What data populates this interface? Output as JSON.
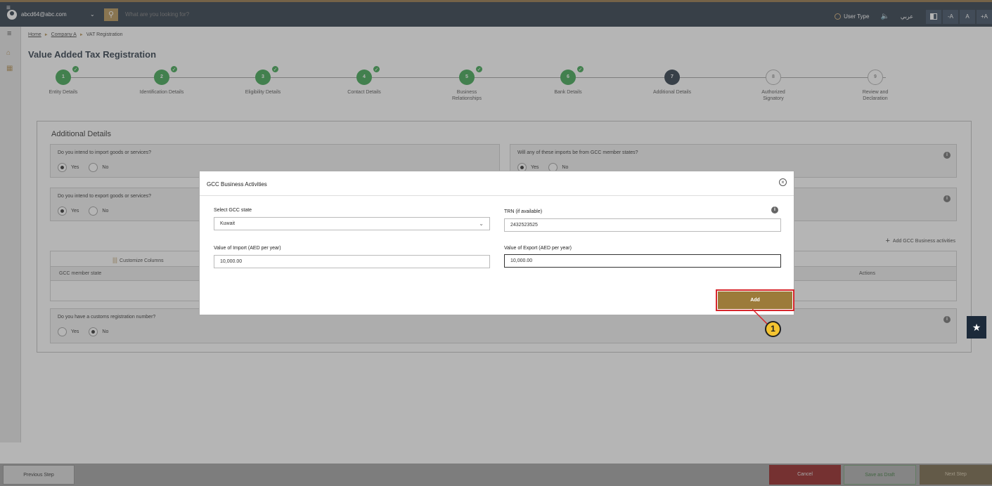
{
  "topbar": {
    "user_email": "abcd64@abc.com",
    "search_placeholder": "What are you looking for?",
    "user_type_label": "User Type",
    "arabic_label": "عربي",
    "font_decrease": "-A",
    "font_reset": "A",
    "font_increase": "+A"
  },
  "breadcrumb": {
    "home": "Home",
    "company": "Company A",
    "current": "VAT Registration"
  },
  "page_title": "Value Added Tax Registration",
  "steps": [
    {
      "num": "1",
      "label": "Entity Details",
      "state": "done"
    },
    {
      "num": "2",
      "label": "Identification Details",
      "state": "done"
    },
    {
      "num": "3",
      "label": "Eligibility Details",
      "state": "done"
    },
    {
      "num": "4",
      "label": "Contact Details",
      "state": "done"
    },
    {
      "num": "5",
      "label": "Business Relationships",
      "state": "done"
    },
    {
      "num": "6",
      "label": "Bank Details",
      "state": "done"
    },
    {
      "num": "7",
      "label": "Additional Details",
      "state": "current"
    },
    {
      "num": "8",
      "label": "Authorized Signatory",
      "state": "todo"
    },
    {
      "num": "9",
      "label": "Review and Declaration",
      "state": "todo"
    }
  ],
  "panel": {
    "title": "Additional Details",
    "q_import": "Do you intend to import goods or services?",
    "q_gcc_import": "Will any of these imports be from GCC member states?",
    "q_export": "Do you intend to export goods or services?",
    "q_customs": "Do you have a customs registration number?",
    "yes": "Yes",
    "no": "No",
    "add_gcc": "Add GCC Business activities",
    "customize_columns": "Customize Columns",
    "col_state": "GCC member state",
    "col_actions": "Actions"
  },
  "modal": {
    "title": "GCC Business Activities",
    "state_label": "Select GCC state",
    "state_value": "Kuwait",
    "trn_label": "TRN (if available)",
    "trn_value": "2432523525",
    "import_label": "Value of Import (AED per year)",
    "import_value": "10,000.00",
    "export_label": "Value of Export (AED per year)",
    "export_value": "10,000.00",
    "add_button": "Add"
  },
  "callout_number": "1",
  "bottombar": {
    "previous": "Previous Step",
    "cancel": "Cancel",
    "save_draft": "Save as Draft",
    "next": "Next Step"
  },
  "colors": {
    "navy": "#1c2a3a",
    "gold": "#9c7b3a",
    "green": "#2f9e44",
    "red": "#d7262c"
  }
}
